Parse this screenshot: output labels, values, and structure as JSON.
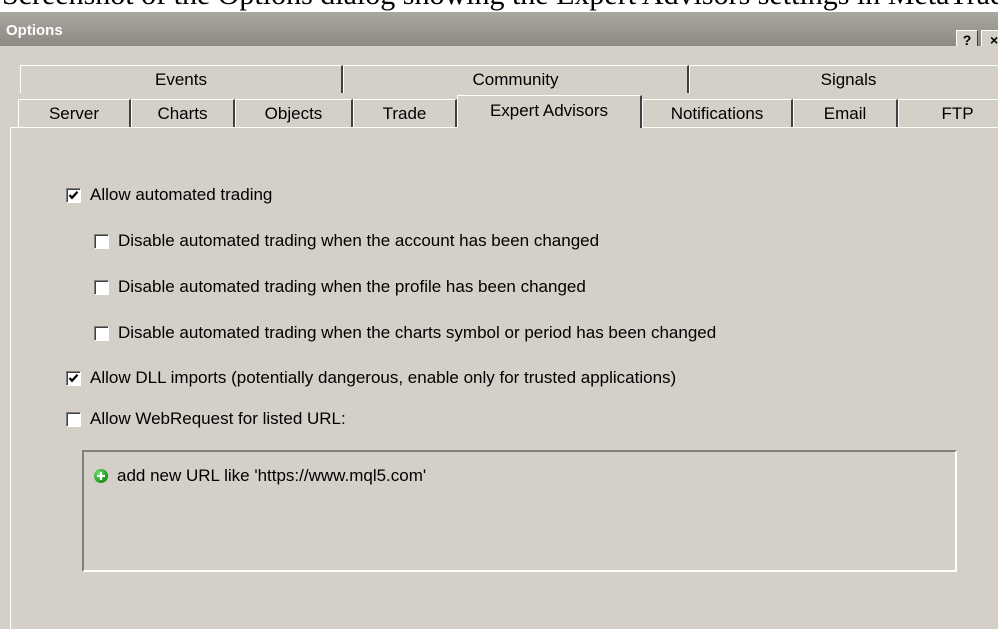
{
  "caption": "Screenshot of the Options dialog showing the Expert Advisors settings in MetaTrader GUI.",
  "window": {
    "title": "Options",
    "help_label": "?",
    "close_label": "×"
  },
  "tabs_row1": [
    {
      "label": "Events"
    },
    {
      "label": "Community"
    },
    {
      "label": "Signals"
    }
  ],
  "tabs_row2": [
    {
      "label": "Server",
      "active": false
    },
    {
      "label": "Charts",
      "active": false
    },
    {
      "label": "Objects",
      "active": false
    },
    {
      "label": "Trade",
      "active": false
    },
    {
      "label": "Expert Advisors",
      "active": true
    },
    {
      "label": "Notifications",
      "active": false
    },
    {
      "label": "Email",
      "active": false
    },
    {
      "label": "FTP",
      "active": false
    }
  ],
  "options": [
    {
      "label": "Allow automated trading",
      "checked": true
    },
    {
      "label": "Disable automated trading when the account has been changed",
      "checked": false
    },
    {
      "label": "Disable automated trading when the profile has been changed",
      "checked": false
    },
    {
      "label": "Disable automated trading when the charts symbol or period has been changed",
      "checked": false
    },
    {
      "label": "Allow DLL imports (potentially dangerous, enable only for trusted applications)",
      "checked": true
    },
    {
      "label": "Allow WebRequest for listed URL:",
      "checked": false
    }
  ],
  "url_list": {
    "add_label": "add new URL like 'https://www.mql5.com'"
  },
  "colors": {
    "dialog_face": "#d4d0c8",
    "titlebar": "#8d8983",
    "check": "#000000",
    "add_icon": "#22a022"
  }
}
